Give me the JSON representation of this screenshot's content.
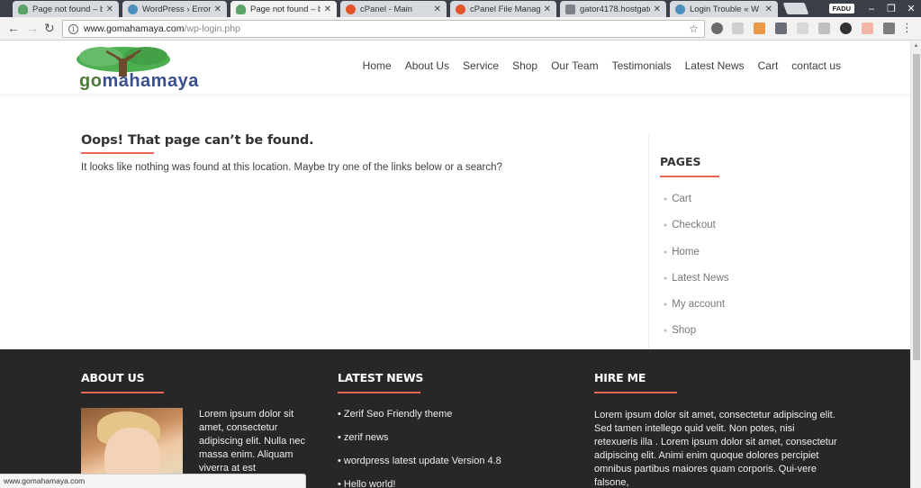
{
  "browser": {
    "tabs": [
      {
        "label": "Page not found – b",
        "favicon": "tree-icon",
        "active": false
      },
      {
        "label": "WordPress › Error",
        "favicon": "wordpress-icon",
        "active": false
      },
      {
        "label": "Page not found – b",
        "favicon": "tree-icon",
        "active": true
      },
      {
        "label": "cPanel - Main",
        "favicon": "cpanel-icon",
        "active": false
      },
      {
        "label": "cPanel File Manage",
        "favicon": "cpanel-icon",
        "active": false
      },
      {
        "label": "gator4178.hostgato",
        "favicon": "server-icon",
        "active": false
      },
      {
        "label": "Login Trouble « W",
        "favicon": "wordpress-icon",
        "active": false
      }
    ],
    "profile": "FADU",
    "address": {
      "host": "www.gomahamaya.com",
      "path": "/wp-login.php"
    },
    "status_url": "www.gomahamaya.com"
  },
  "site": {
    "logo": {
      "prefix": "go",
      "name": "mahamaya"
    },
    "nav": [
      "Home",
      "About Us",
      "Service",
      "Shop",
      "Our Team",
      "Testimonials",
      "Latest News",
      "Cart",
      "contact us"
    ],
    "error": {
      "title": "Oops! That page can’t be found.",
      "message": "It looks like nothing was found at this location. Maybe try one of the links below or a search?"
    },
    "sidebar": {
      "title": "PAGES",
      "items": [
        "Cart",
        "Checkout",
        "Home",
        "Latest News",
        "My account",
        "Shop"
      ]
    },
    "footer": {
      "about": {
        "title": "ABOUT US",
        "text": "Lorem ipsum dolor sit amet, consectetur adipiscing elit. Nulla nec massa enim. Aliquam viverra at est"
      },
      "news": {
        "title": "LATEST NEWS",
        "items": [
          "Zerif Seo Friendly theme",
          "zerif news",
          "wordpress latest update Version 4.8",
          "Hello world!"
        ]
      },
      "hire": {
        "title": "HIRE ME",
        "text": "Lorem ipsum dolor sit amet, consectetur adipiscing elit. Sed tamen intellego quid velit. Non potes, nisi retexueris illa . Lorem ipsum dolor sit amet, consectetur adipiscing elit. Animi enim quoque dolores percipiet omnibus partibus maiores quam corporis. Qui-vere falsone,"
      }
    }
  },
  "colors": {
    "accent": "#e96656",
    "footer_bg": "#272727",
    "chrome_dark": "#3b3f47"
  }
}
